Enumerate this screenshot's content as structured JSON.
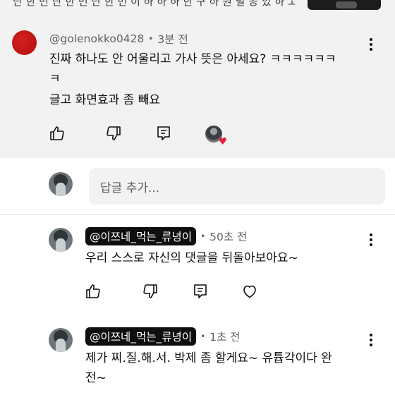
{
  "top_strip": {
    "text": "단 한 번 단 한 번 단 한 번 이 하 하 하 한 구 하 원 별 공 있 하 고 이 하 공..."
  },
  "pinned_comment": {
    "username": "@golenokko0428",
    "time": "3분 전",
    "text_line1": "진짜 하나도 안 어울리고 가사 뜻은 아세요? ㅋㅋㅋㅋㅋㅋ",
    "text_line2": "ㅋ",
    "text_line3": "글고 화면효과 좀 빼요",
    "actions": {
      "like_icon": "thumb-up-icon",
      "dislike_icon": "thumb-down-icon",
      "reply_icon": "reply-icon",
      "hearted_icon": "heart-icon",
      "heart_color": "#e0243b"
    }
  },
  "reply_input": {
    "placeholder": "답글 추가..."
  },
  "replies": [
    {
      "handle": "@이쯔네_먹는_류녕이",
      "time": "50초 전",
      "text_line1": "우리 스스로 자신의 댓글을 뒤돌아보아요~",
      "text_line2": ""
    },
    {
      "handle": "@이쯔네_먹는_류녕이",
      "time": "1초 전",
      "text_line1": "제가 찌.질.해.서. 박제 좀 할게요~ 유튭각이다 완",
      "text_line2": "전~"
    }
  ],
  "colors": {
    "pinned_bg": "#f2f2f2",
    "badge_bg": "#0f0f0f",
    "badge_text": "#ffffff",
    "avatar_red": "#c51515"
  }
}
